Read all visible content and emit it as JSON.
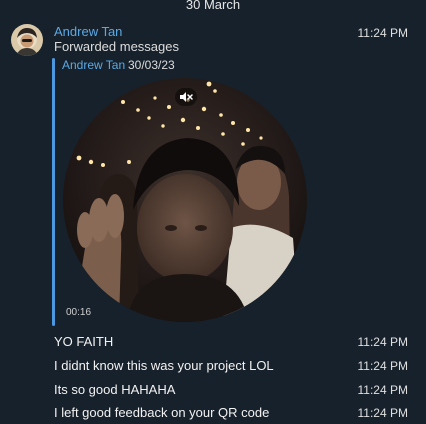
{
  "date_separator": "30 March",
  "message": {
    "sender": "Andrew Tan",
    "time": "11:24 PM",
    "forwarded_label": "Forwarded messages",
    "forwarded_from": {
      "author": "Andrew Tan",
      "date": "30/03/23"
    },
    "video": {
      "duration": "00:16",
      "muted_icon": "speaker-muted-icon"
    }
  },
  "followups": [
    {
      "text": "YO FAITH",
      "time": "11:24 PM"
    },
    {
      "text": "I didnt know this was your project LOL",
      "time": "11:24 PM"
    },
    {
      "text": "Its so good HAHAHA",
      "time": "11:24 PM"
    },
    {
      "text": "I left good feedback on your QR code",
      "time": "11:24 PM"
    }
  ],
  "colors": {
    "background": "#17212b",
    "accent": "#5aa9e6",
    "forward_bar": "#4b97e0"
  }
}
